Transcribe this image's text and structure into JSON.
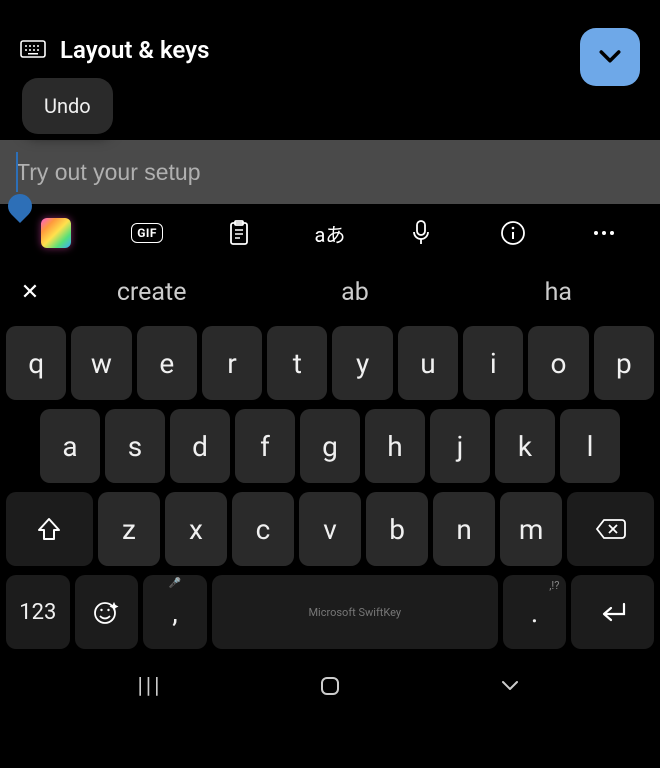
{
  "header": {
    "title": "Layout & keys"
  },
  "undo_popup": {
    "label": "Undo"
  },
  "test_input": {
    "placeholder": "Try out your setup",
    "value": ""
  },
  "toolbar": {
    "gif_label": "GIF",
    "translate_label": "aあ"
  },
  "suggestions": {
    "close_glyph": "✕",
    "items": [
      "create",
      "ab",
      "ha"
    ]
  },
  "keyboard": {
    "row1": [
      "q",
      "w",
      "e",
      "r",
      "t",
      "y",
      "u",
      "i",
      "o",
      "p"
    ],
    "row2": [
      "a",
      "s",
      "d",
      "f",
      "g",
      "h",
      "j",
      "k",
      "l"
    ],
    "row3": [
      "z",
      "x",
      "c",
      "v",
      "b",
      "n",
      "m"
    ],
    "numeric_label": "123",
    "comma": ",",
    "comma_mini": "🎤",
    "space_label": "Microsoft SwiftKey",
    "period": ".",
    "period_mini": ",!?",
    "enter_glyph": "↵"
  },
  "navbar": {
    "recents": "|||"
  }
}
